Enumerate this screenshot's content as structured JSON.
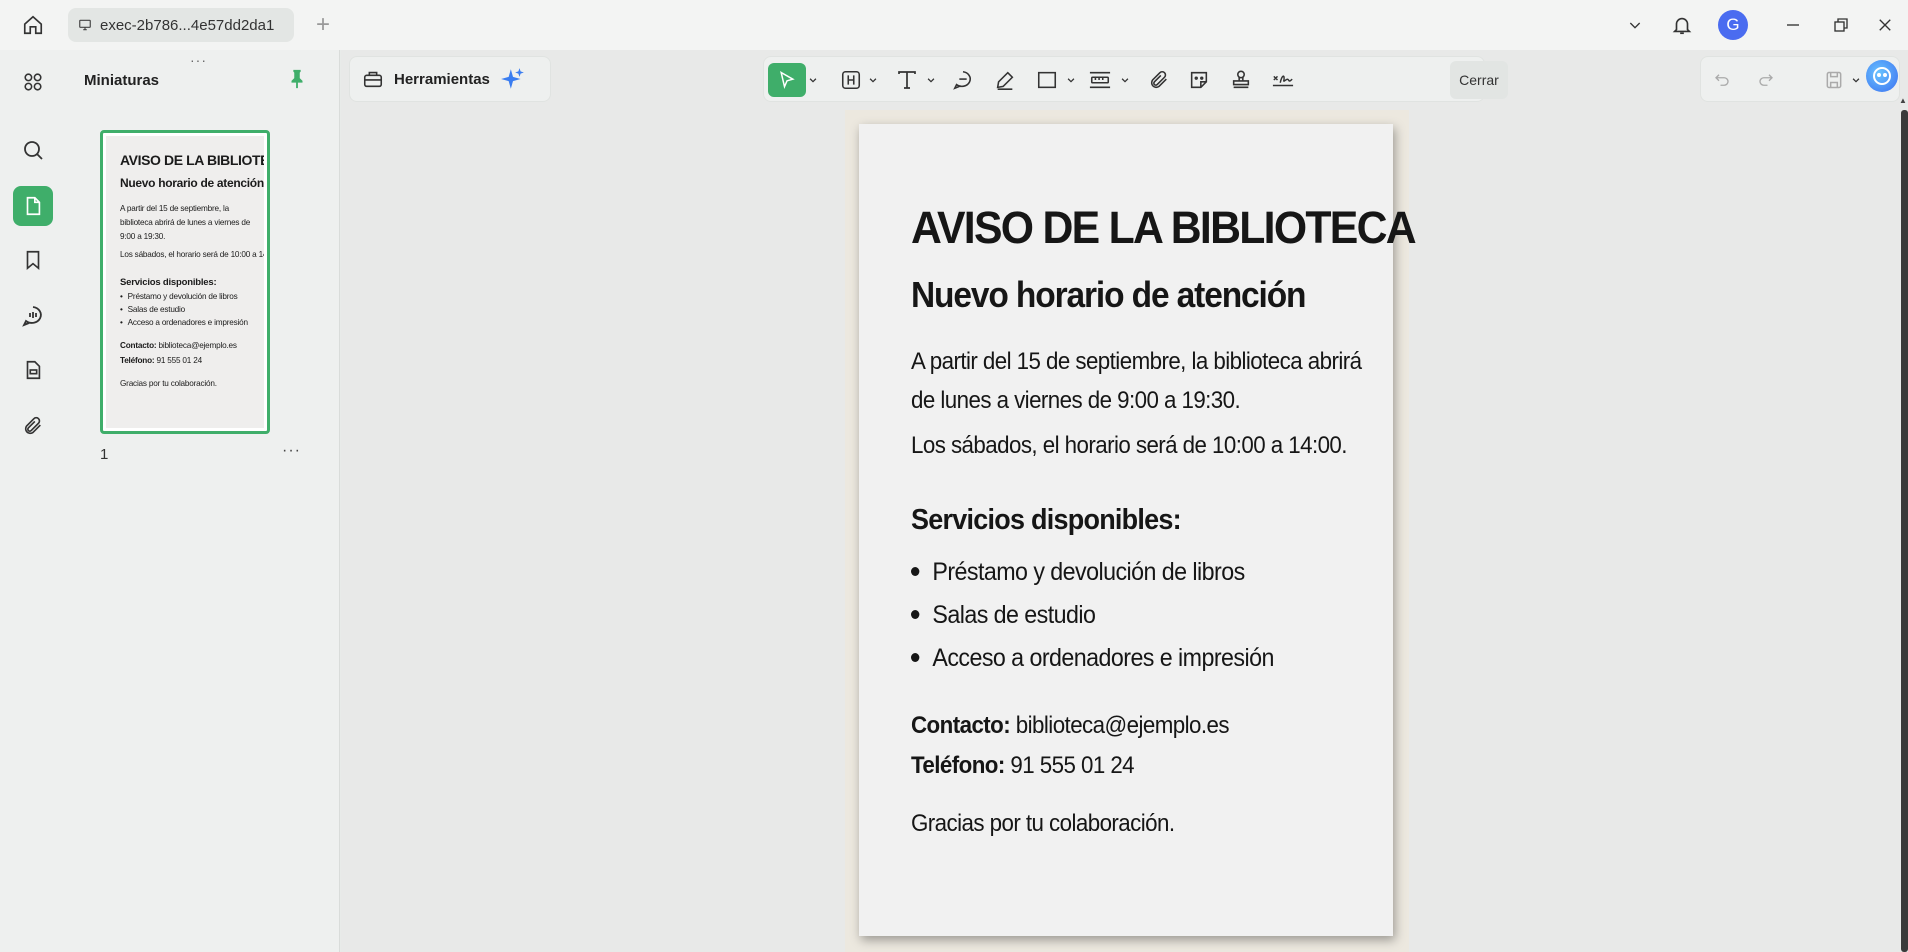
{
  "titlebar": {
    "tab_title": "exec-2b786...4e57dd2da1",
    "avatar_letter": "G"
  },
  "thumbnails": {
    "title": "Miniaturas",
    "page_number": "1",
    "more": "···",
    "handle": "···"
  },
  "toolbar": {
    "tools_label": "Herramientas",
    "close_label": "Cerrar"
  },
  "document": {
    "heading": "AVISO DE LA BIBLIOTECA",
    "subheading": "Nuevo horario de atención",
    "paragraph1": "A partir del 15 de septiembre, la biblioteca abrirá de lunes a viernes de 9:00 a 19:30.",
    "paragraph2": "Los sábados, el horario será de 10:00 a 14:00.",
    "services_title": "Servicios disponibles:",
    "services": [
      "Préstamo y devolución de libros",
      "Salas de estudio",
      "Acceso a ordenadores e impresión"
    ],
    "contact_label": "Contacto:",
    "contact_value": "biblioteca@ejemplo.es",
    "phone_label": "Teléfono:",
    "phone_value": "91 555 01 24",
    "thanks": "Gracias por tu colaboración."
  },
  "colors": {
    "accent": "#3fae6a",
    "background": "#e8e9e8"
  }
}
